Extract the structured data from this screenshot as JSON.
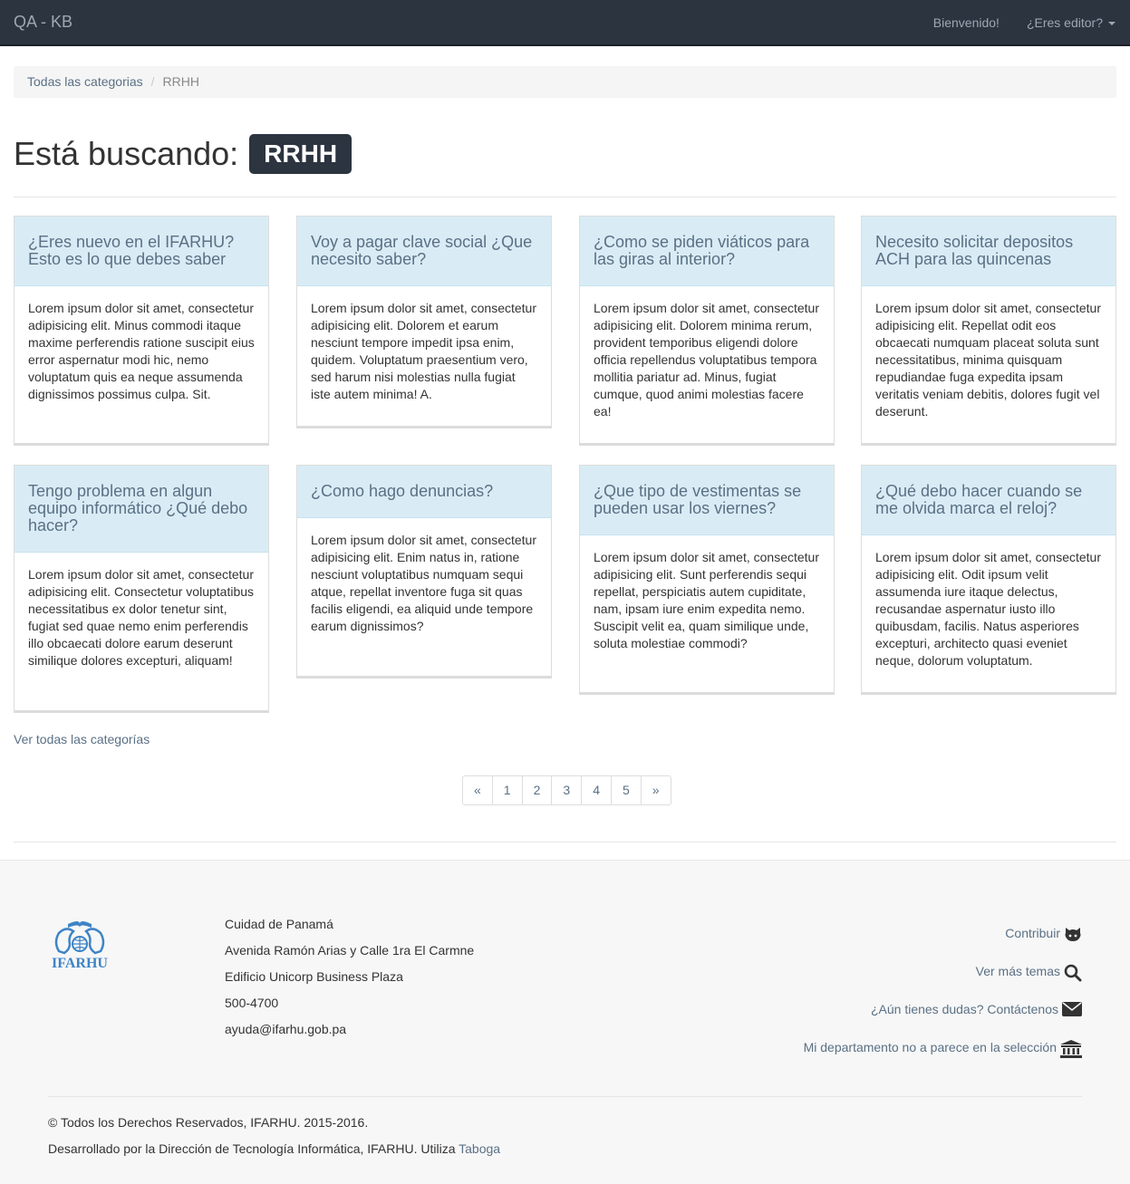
{
  "navbar": {
    "brand": "QA - KB",
    "welcome": "Bienvenido!",
    "editor": "¿Eres editor?"
  },
  "breadcrumb": {
    "root": "Todas las categorias",
    "current": "RRHH"
  },
  "heading": {
    "prefix": "Está buscando:",
    "tag": "RRHH"
  },
  "cards": [
    {
      "title": "¿Eres nuevo en el IFARHU? Esto es lo que debes saber",
      "body": "Lorem ipsum dolor sit amet, consectetur adipisicing elit. Minus commodi itaque maxime perferendis ratione suscipit eius error aspernatur modi hic, nemo voluptatum quis ea neque assumenda dignissimos possimus culpa. Sit."
    },
    {
      "title": "Voy a pagar clave social ¿Que necesito saber?",
      "body": "Lorem ipsum dolor sit amet, consectetur adipisicing elit. Dolorem et earum nesciunt tempore impedit ipsa enim, quidem. Voluptatum praesentium vero, sed harum nisi molestias nulla fugiat iste autem minima! A."
    },
    {
      "title": "¿Como se piden viáticos para las giras al interior?",
      "body": "Lorem ipsum dolor sit amet, consectetur adipisicing elit. Dolorem minima rerum, provident temporibus eligendi dolore officia repellendus voluptatibus tempora mollitia pariatur ad. Minus, fugiat cumque, quod animi molestias facere ea!"
    },
    {
      "title": "Necesito solicitar depositos ACH para las quincenas",
      "body": "Lorem ipsum dolor sit amet, consectetur adipisicing elit. Repellat odit eos obcaecati numquam placeat soluta sunt necessitatibus, minima quisquam repudiandae fuga expedita ipsam veritatis veniam debitis, dolores fugit vel deserunt."
    },
    {
      "title": "Tengo problema en algun equipo informático ¿Qué debo hacer?",
      "body": "Lorem ipsum dolor sit amet, consectetur adipisicing elit. Consectetur voluptatibus necessitatibus ex dolor tenetur sint, fugiat sed quae nemo enim perferendis illo obcaecati dolore earum deserunt similique dolores excepturi, aliquam!"
    },
    {
      "title": "¿Como hago denuncias?",
      "body": "Lorem ipsum dolor sit amet, consectetur adipisicing elit. Enim natus in, ratione nesciunt voluptatibus numquam sequi atque, repellat inventore fuga sit quas facilis eligendi, ea aliquid unde tempore earum dignissimos?"
    },
    {
      "title": "¿Que tipo de vestimentas se pueden usar los viernes?",
      "body": "Lorem ipsum dolor sit amet, consectetur adipisicing elit. Sunt perferendis sequi repellat, perspiciatis autem cupiditate, nam, ipsam iure enim expedita nemo. Suscipit velit ea, quam similique unde, soluta molestiae commodi?"
    },
    {
      "title": "¿Qué debo hacer cuando se me olvida marca el reloj?",
      "body": "Lorem ipsum dolor sit amet, consectetur adipisicing elit. Odit ipsum velit assumenda iure itaque delectus, recusandae aspernatur iusto illo quibusdam, facilis. Natus asperiores excepturi, architecto quasi eveniet neque, dolorum voluptatum."
    }
  ],
  "see_all": "Ver todas las categorías",
  "pagination": {
    "prev": "«",
    "pages": [
      "1",
      "2",
      "3",
      "4",
      "5"
    ],
    "next": "»"
  },
  "footer": {
    "logo_text": "IFARHU",
    "address": [
      "Cuidad de Panamá",
      "Avenida Ramón Arias y Calle 1ra El Carmne",
      "Edificio Unicorp Business Plaza",
      "500-4700",
      "ayuda@ifarhu.gob.pa"
    ],
    "links": {
      "contribute": "Contribuir",
      "more_topics": "Ver más temas",
      "contact": "¿Aún tienes dudas? Contáctenos",
      "department": "Mi departamento no a parece en la selección"
    },
    "copyright": "© Todos los Derechos Reservados, IFARHU. 2015-2016.",
    "developed_by": "Desarrollado por la Dirección de Tecnología Informática, IFARHU. Utiliza",
    "developed_link": "Taboga"
  },
  "colors": {
    "navbar": "#2c3440",
    "card_header": "#d9ecf5",
    "link": "#5a7085",
    "logo": "#3d84c6"
  }
}
